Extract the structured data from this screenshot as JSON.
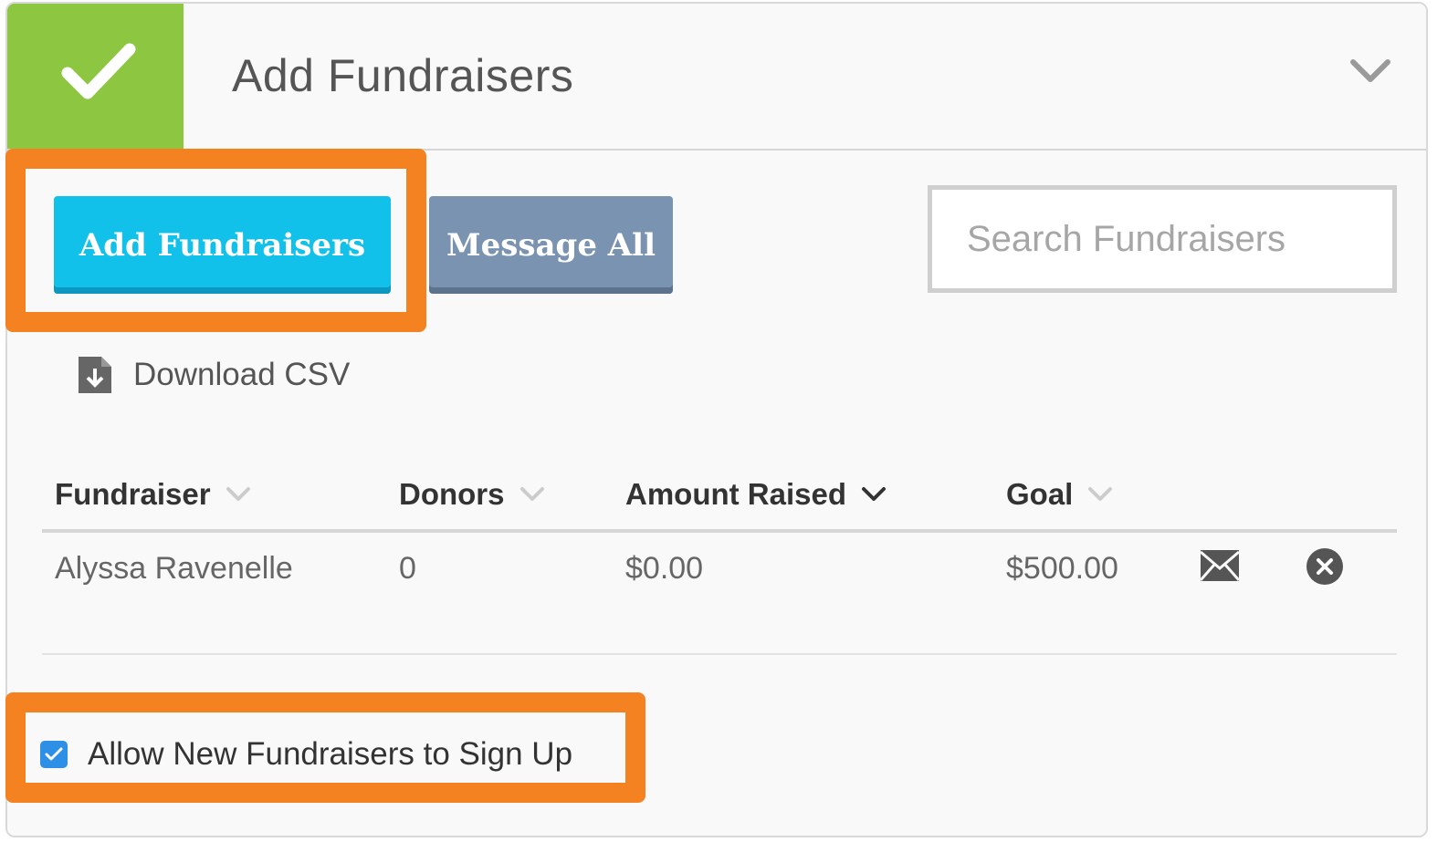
{
  "header": {
    "title": "Add Fundraisers",
    "status_color": "#8dc641"
  },
  "toolbar": {
    "add_label": "Add Fundraisers",
    "message_label": "Message All",
    "add_color": "#12c1ea",
    "message_color": "#7a93b1"
  },
  "search": {
    "placeholder": "Search Fundraisers",
    "value": ""
  },
  "download": {
    "label": "Download CSV",
    "icon": "file-download-icon"
  },
  "table": {
    "columns": [
      "Fundraiser",
      "Donors",
      "Amount Raised",
      "Goal"
    ],
    "active_sort_column": "Amount Raised",
    "rows": [
      {
        "fundraiser": "Alyssa Ravenelle",
        "donors": "0",
        "amount_raised": "$0.00",
        "goal": "$500.00",
        "actions": [
          "envelope-icon",
          "remove-circle-icon"
        ]
      }
    ]
  },
  "allow_signup": {
    "label": "Allow New Fundraisers to Sign Up",
    "checked": true
  },
  "highlight_color": "#f58220"
}
